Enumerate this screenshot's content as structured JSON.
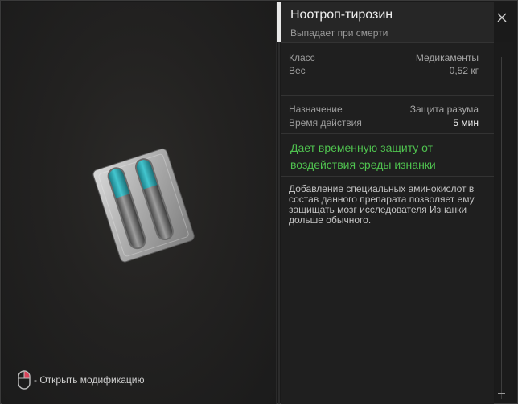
{
  "item": {
    "name": "Ноотроп-тирозин",
    "drop_status": "Выпадает при смерти"
  },
  "stats_primary": [
    {
      "label": "Класс",
      "value": "Медикаменты"
    },
    {
      "label": "Вес",
      "value": "0,52 кг"
    }
  ],
  "stats_secondary": [
    {
      "label": "Назначение",
      "value": "Защита разума"
    },
    {
      "label": "Время действия",
      "value": "5 мин"
    }
  ],
  "effect_text": "Дает временную защиту от воздействия среды изнанки",
  "description": "Добавление специальных аминокислот в состав данного препарата позволяет ему защищать мозг исследователя Изнанки дольше обычного.",
  "hint": {
    "text": "- Открыть модификацию",
    "icon": "mouse-icon"
  },
  "colors": {
    "effect": "#4fc24f",
    "accent": "#e9e9e9",
    "capsule_tip": "#2aa7b1"
  }
}
